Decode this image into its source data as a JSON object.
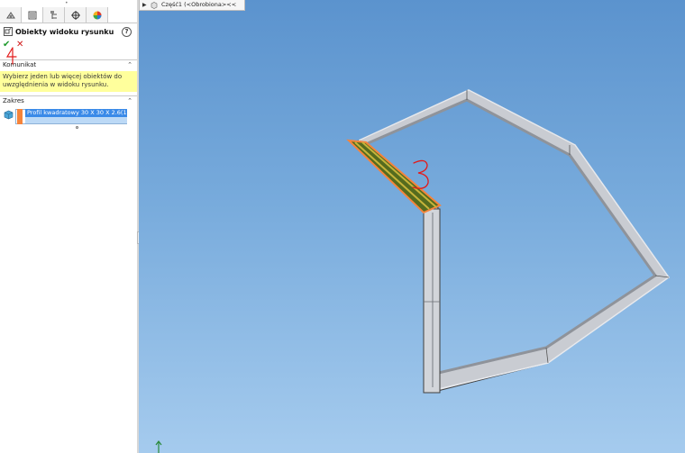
{
  "breadcrumb": {
    "text": "Część1 (<Obrobiona><<"
  },
  "property_manager": {
    "tabs": [
      {
        "icon": "feature-manager-icon"
      },
      {
        "icon": "property-manager-icon"
      },
      {
        "icon": "configuration-manager-icon"
      },
      {
        "icon": "dimxpert-icon"
      },
      {
        "icon": "display-manager-icon"
      }
    ],
    "title": "Obiekty widoku rysunku",
    "help_label": "?",
    "ok_label": "✔",
    "cancel_label": "✕",
    "message_section": {
      "label": "Komunikat",
      "text": "Wybierz jeden lub więcej obiektów do uwzględnienia w widoku rysunku."
    },
    "scope_section": {
      "label": "Zakres",
      "selected_item": "Profil kwadratowy 30 X 30 X 2.6(1)[1]",
      "highlight_color": "#f5843b"
    }
  },
  "annotations": {
    "handwritten_1": "4",
    "handwritten_2": "3",
    "color": "#e21b1b"
  },
  "viewport": {
    "background_top": "#5b93ce",
    "background_bottom": "#a5cbee",
    "selection_color": "#f5843b"
  }
}
